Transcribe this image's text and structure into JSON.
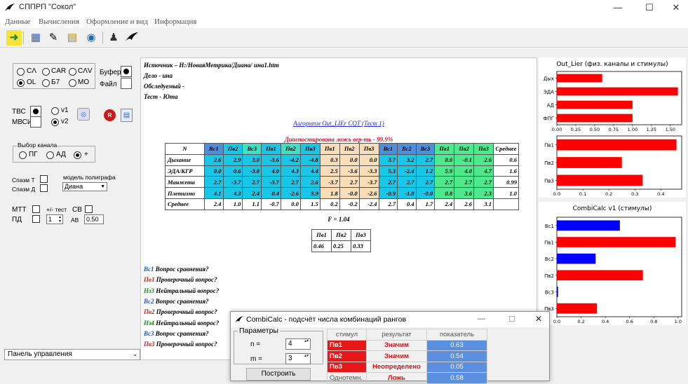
{
  "app": {
    "title": "СППРП \"Сокол\"",
    "win_min": "—",
    "win_max": "☐",
    "win_close": "✕"
  },
  "menu": [
    "Данные",
    "Вычисления",
    "Оформление и вид",
    "Информация"
  ],
  "left": {
    "modes": [
      "CΛ",
      "CAR",
      "CΛV",
      "OL",
      "Б7",
      "MO"
    ],
    "selected_mode": "OL",
    "buffer_label": "Буфер",
    "file_label": "Файл",
    "tvs": "ТВС",
    "mvsi": "МВСИ",
    "v1": "v1",
    "v2": "v2",
    "channel_group": "Выбор канала",
    "ch_pg": "ПГ",
    "ch_ad": "АД",
    "ch_plus": "+",
    "spasm_t": "Спазм Т",
    "spasm_d": "Спазм Д",
    "model_label": "модель полиграфа",
    "model_value": "Диана",
    "mtt": "МТТ",
    "test_label": "+/- тест",
    "sv": "СВ",
    "pd": "ПД",
    "pd_value": "1",
    "av": "АВ",
    "av_value": "0.50",
    "panel": "Панель управления"
  },
  "report": {
    "source": "Источник – H:/НоваяМетрика/Диана/          ина1.htm",
    "case": "Дело -                    ина",
    "subject": "Обследуемый -",
    "test": "Тест - Юта",
    "algo": "Алгоритм Out_LIEr CQT (Тест 1)",
    "diag": "Диагностирована ложь вер-ть - 99.9%",
    "headers": [
      "N",
      "Вс1",
      "Пв2",
      "Вс3",
      "Пв1",
      "Пв2",
      "Пв3",
      "Пв1",
      "Пв2",
      "Пв3",
      "Вс1",
      "Вс2",
      "Вс3",
      "Пв1",
      "Пв2",
      "Пв3",
      "Среднее"
    ],
    "rows": [
      {
        "name": "Дыхание",
        "cells": [
          "2.6",
          "2.9",
          "3.0",
          "-3.6",
          "-4.2",
          "-4.8",
          "0.3",
          "0.0",
          "0.0",
          "3.7",
          "3.2",
          "2.7",
          "0.0",
          "-0.1",
          "2.6",
          "0.6"
        ]
      },
      {
        "name": "ЭДА/КГР",
        "cells": [
          "0.0",
          "0.6",
          "-3.8",
          "4.0",
          "4.3",
          "4.4",
          "2.5",
          "-3.6",
          "-3.3",
          "5.3",
          "-2.4",
          "1.2",
          "5.9",
          "4.0",
          "4.7",
          "1.6"
        ]
      },
      {
        "name": "Манжета",
        "cells": [
          "2.7",
          "-3.7",
          "2.7",
          "-3.7",
          "2.7",
          "2.6",
          "-3.7",
          "2.7",
          "-3.7",
          "2.7",
          "2.7",
          "2.7",
          "2.7",
          "2.7",
          "2.7",
          "0.99"
        ]
      },
      {
        "name": "Плетизмо",
        "cells": [
          "4.1",
          "4.3",
          "2.4",
          "0.4",
          "-2.6",
          "3.9",
          "1.8",
          "-0.0",
          "-2.6",
          "-0.9",
          "-1.8",
          "-0.0",
          "0.8",
          "3.6",
          "2.3",
          "1.0"
        ]
      },
      {
        "name": "Среднее",
        "cells": [
          "2.4",
          "1.0",
          "1.1",
          "-0.7",
          "0.0",
          "1.5",
          "0.2",
          "-0.2",
          "-2.4",
          "2.7",
          "0.4",
          "1.7",
          "2.4",
          "2.6",
          "3.1",
          ""
        ]
      }
    ],
    "f_value": "F = 1.04",
    "f_headers": [
      "Пв1",
      "Пв2",
      "Пв3"
    ],
    "f_values": [
      "0.46",
      "0.25",
      "0.33"
    ],
    "legend": [
      {
        "code": "Вс1",
        "text": " Вопрос сравнения?",
        "color": "#1a4fd6"
      },
      {
        "code": "Пв1",
        "text": " Проверочный вопрос?",
        "color": "#d61a1a"
      },
      {
        "code": "Нз3",
        "text": " Нейтральный вопрос?",
        "color": "#1a8a1a"
      },
      {
        "code": "Вс2",
        "text": " Вопрос сравнения?",
        "color": "#1a4fd6"
      },
      {
        "code": "Пв2",
        "text": " Проверочный вопрос?",
        "color": "#d61a1a"
      },
      {
        "code": "Нз4",
        "text": " Нейтральный вопрос?",
        "color": "#1a8a1a"
      },
      {
        "code": "Вс3",
        "text": " Вопрос сравнения?",
        "color": "#1a4fd6"
      },
      {
        "code": "Пв3",
        "text": " Проверочный вопрос?",
        "color": "#d61a1a"
      }
    ]
  },
  "chart_data": [
    {
      "type": "bar",
      "orientation": "horizontal",
      "title": "Out_Lier (физ. каналы и стимулы)",
      "categories": [
        "Дых",
        "ЭДА",
        "АД",
        "ФПГ"
      ],
      "values": [
        0.6,
        1.6,
        1.0,
        1.0
      ],
      "xlim": [
        0,
        1.65
      ],
      "xticks": [
        "0.00",
        "0.25",
        "0.50",
        "0.75",
        "1.00",
        "1.25",
        "1.50"
      ],
      "colors": [
        "#ff0000",
        "#ff0000",
        "#ff0000",
        "#ff0000"
      ]
    },
    {
      "type": "bar",
      "orientation": "horizontal",
      "title": "",
      "categories": [
        "Пв1",
        "Пв2",
        "Пв3"
      ],
      "values": [
        0.46,
        0.25,
        0.33
      ],
      "xlim": [
        0,
        0.48
      ],
      "xticks": [
        "0.0",
        "0.1",
        "0.2",
        "0.3",
        "0.4"
      ],
      "colors": [
        "#ff0000",
        "#ff0000",
        "#ff0000"
      ]
    },
    {
      "type": "bar",
      "orientation": "horizontal",
      "title": "CombiCalc v1 (стимулы)",
      "categories": [
        "Вс1",
        "Пв1",
        "Вс2",
        "Пв2",
        "Вс3",
        "Пв3"
      ],
      "values": [
        0.52,
        0.98,
        0.32,
        0.71,
        0.01,
        0.33
      ],
      "xlim": [
        0,
        1.03
      ],
      "xticks": [
        "0.0",
        "0.2",
        "0.4",
        "0.6",
        "0.8",
        "1.0"
      ],
      "colors": [
        "#0000ff",
        "#ff0000",
        "#0000ff",
        "#ff0000",
        "#0000ff",
        "#ff0000"
      ]
    }
  ],
  "dialog": {
    "title": "CombiCalc - подсчёт числа комбинаций рангов",
    "params": "Параметры",
    "n_label": "n =",
    "n_value": "4",
    "m_label": "m =",
    "m_value": "3",
    "build": "Построить",
    "headers": [
      "стимул",
      "результат",
      "показатель"
    ],
    "rows": [
      {
        "stim": "Пв1",
        "res": "Значим",
        "val": "0.63"
      },
      {
        "stim": "Пв2",
        "res": "Значим",
        "val": "0.54"
      },
      {
        "stim": "Пв3",
        "res": "Неопределено",
        "val": "0.05"
      },
      {
        "stim": "Однотемн.",
        "res": "Ложь",
        "val": "0.58"
      }
    ],
    "value_fill": [
      0.63,
      0.54,
      0.05,
      0.58
    ]
  }
}
